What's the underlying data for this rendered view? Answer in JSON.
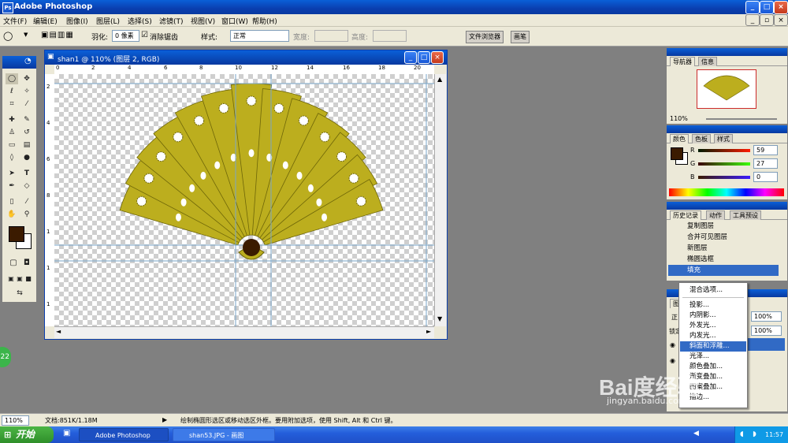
{
  "app": {
    "title": "Adobe Photoshop"
  },
  "menu": [
    "文件(F)",
    "编辑(E)",
    "图像(I)",
    "图层(L)",
    "选择(S)",
    "滤镜(T)",
    "视图(V)",
    "窗口(W)",
    "帮助(H)"
  ],
  "options": {
    "feather_label": "羽化:",
    "feather_value": "0 像素",
    "antialias_label": "消除锯齿",
    "style_label": "样式:",
    "style_value": "正常",
    "width_label": "宽度:",
    "height_label": "高度:",
    "file_browser_tab": "文件浏览器",
    "brushes_tab": "画笔"
  },
  "document": {
    "title": "shan1 @ 110% (图层 2, RGB)",
    "ruler_h": [
      "0",
      "2",
      "4",
      "6",
      "8",
      "10",
      "12",
      "14",
      "16",
      "18",
      "20"
    ],
    "ruler_v": [
      "2",
      "4",
      "6",
      "8",
      "1",
      "1",
      "1"
    ]
  },
  "navigator": {
    "tabs": [
      "导航器",
      "信息"
    ],
    "zoom": "110%"
  },
  "color": {
    "tabs": [
      "颜色",
      "色板",
      "样式"
    ],
    "r_label": "R",
    "r_value": "59",
    "g_label": "G",
    "g_value": "27",
    "b_label": "B",
    "b_value": "0",
    "foreground": "#3b1b00"
  },
  "history": {
    "tabs": [
      "历史记录",
      "动作",
      "工具预设"
    ],
    "items": [
      "复制图层",
      "合并可见图层",
      "新图层",
      "椭圆选框",
      "填充"
    ]
  },
  "layers": {
    "tab": "图",
    "mode": "正",
    "lock_label": "锁定",
    "opacity": "100%",
    "fill": "100%"
  },
  "context_menu": {
    "items": [
      "混合选项...",
      "投影...",
      "内阴影...",
      "外发光...",
      "内发光...",
      "斜面和浮雕...",
      "光泽...",
      "颜色叠加...",
      "渐变叠加...",
      "图案叠加...",
      "描边..."
    ],
    "selected_index": 5
  },
  "status": {
    "zoom": "110%",
    "doc_size": "文档:851K/1.18M",
    "hint": "绘制椭圆形选区或移动选区外框。要用附加选项，使用 Shift, Alt 和 Ctrl 键。"
  },
  "taskbar": {
    "start": "开始",
    "tasks": [
      "Adobe Photoshop",
      "shan53.JPG - 画图"
    ],
    "time": "11:57"
  },
  "watermark": {
    "brand": "Bai度经验",
    "url": "jingyan.baidu.com"
  },
  "badge": "22",
  "colors": {
    "fan": "#bcae1e",
    "fan_edge": "#6e6608",
    "xp_blue": "#0a5fd8",
    "selection": "#316ac5"
  }
}
